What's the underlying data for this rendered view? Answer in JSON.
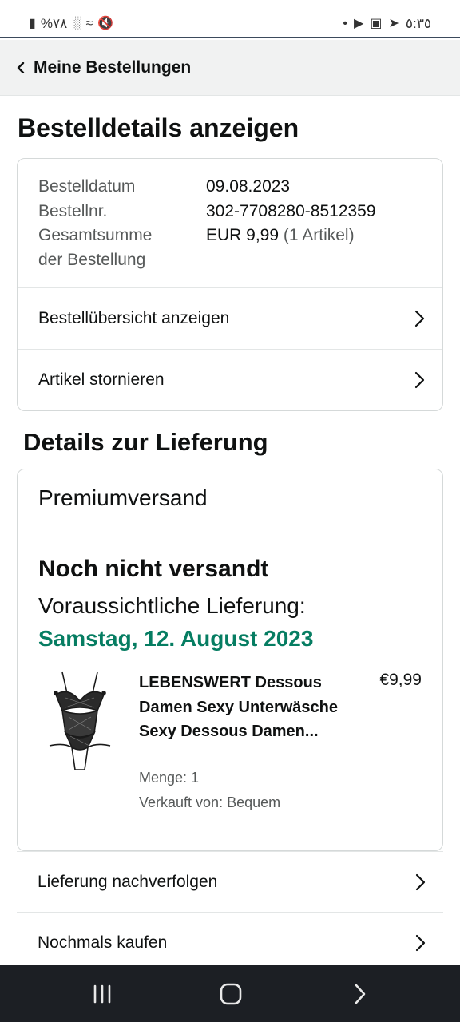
{
  "status_bar": {
    "left_text": "%٧٨",
    "clock": "٥:٣٥"
  },
  "header": {
    "back_label": "Meine Bestellungen"
  },
  "page": {
    "title": "Bestelldetails anzeigen"
  },
  "order_summary": {
    "rows": [
      {
        "label": "Bestelldatum",
        "value": "09.08.2023"
      },
      {
        "label": "Bestellnr.",
        "value": "302-7708280-8512359"
      }
    ],
    "total_label_line1": "Gesamtsumme",
    "total_label_line2": "der Bestellung",
    "total_value": "EUR 9,99",
    "total_items": "(1 Artikel)",
    "links": [
      "Bestellübersicht anzeigen",
      "Artikel stornieren"
    ]
  },
  "delivery": {
    "section_title": "Details zur Lieferung",
    "shipping_speed": "Premiumversand",
    "status": "Noch nicht versandt",
    "eta_label": "Voraussichtliche Lieferung:",
    "eta_date": "Samstag, 12. August 2023",
    "eta_color": "#067d62",
    "item": {
      "title": "LEBENSWERT Dessous Damen Sexy Unterwäsche Sexy Dessous Damen...",
      "price": "€9,99",
      "quantity": "Menge: 1",
      "seller": "Verkauft von: Bequem"
    }
  },
  "actions": [
    "Lieferung nachverfolgen",
    "Nochmals kaufen"
  ]
}
